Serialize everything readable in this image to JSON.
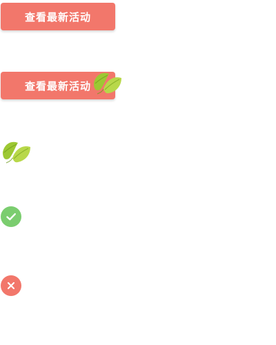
{
  "buttons": {
    "view_latest_activity_label": "查看最新活动",
    "view_latest_activity_label_leaf": "查看最新活动"
  },
  "icons": {
    "leaf_1": "leaf-icon",
    "leaf_2": "leaf-icon",
    "success": "check-circle-icon",
    "error": "close-circle-icon"
  },
  "colors": {
    "button_bg": "#f2776b",
    "leaf_light": "#b8d84a",
    "leaf_dark": "#8fbe2a",
    "success": "#7bcd6f",
    "error": "#f2776b"
  }
}
